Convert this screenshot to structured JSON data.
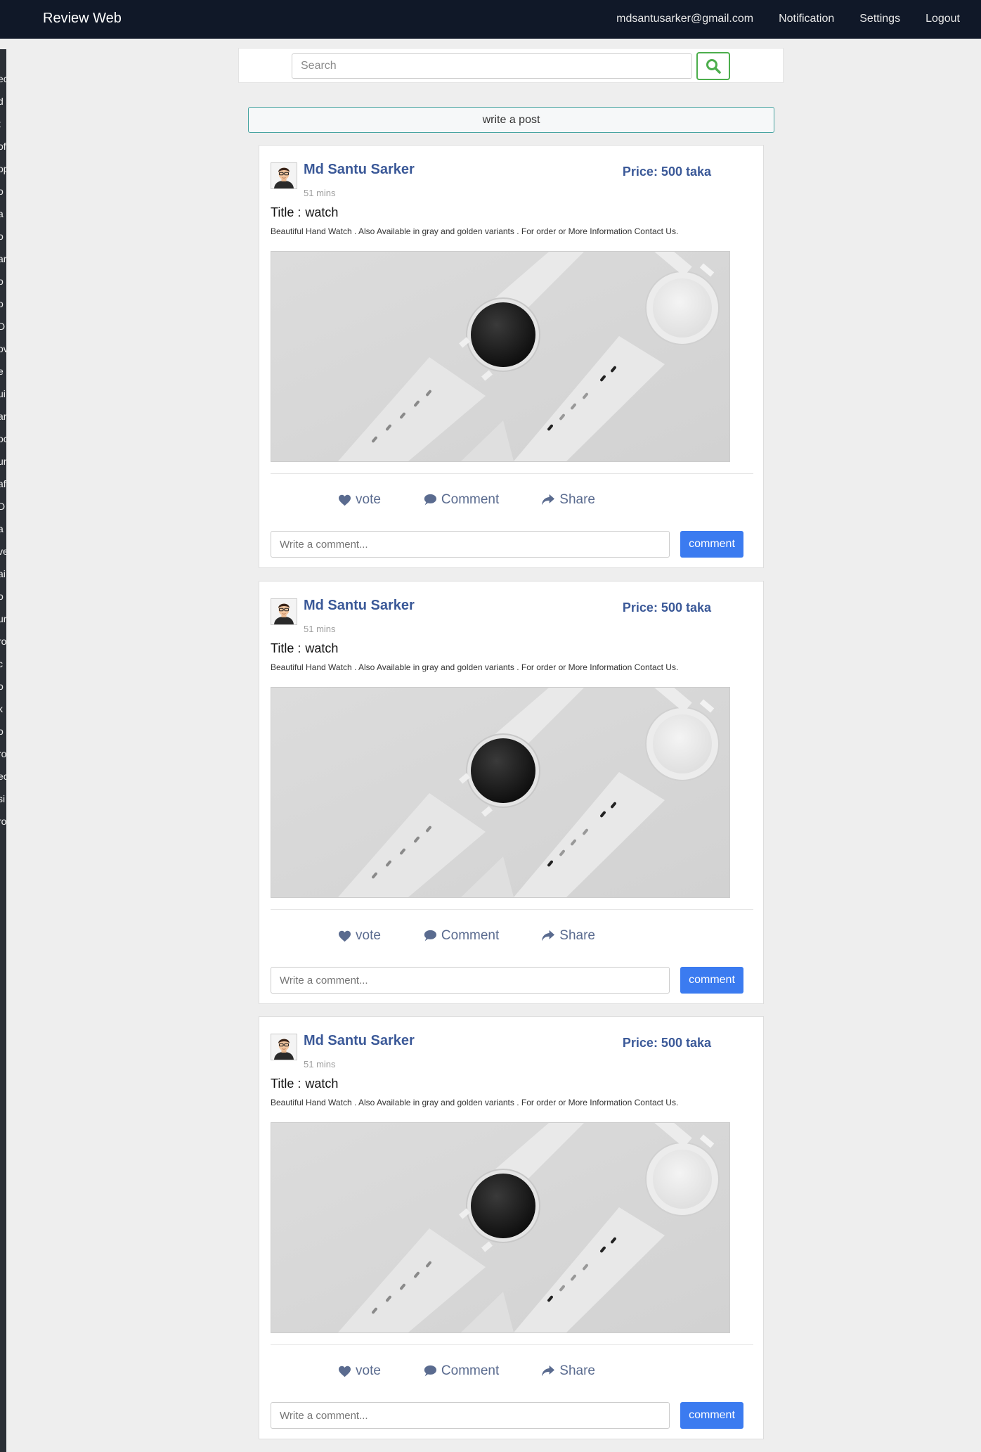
{
  "navbar": {
    "brand": "Review Web",
    "email": "mdsantusarker@gmail.com",
    "notification": "Notification",
    "settings": "Settings",
    "logout": "Logout"
  },
  "sidebar": {
    "items": [
      "ec",
      "d",
      "t",
      "of",
      "op",
      "o",
      "a",
      "o",
      "ar",
      "o",
      "o",
      "D",
      "ov",
      "e",
      "ui",
      "ar",
      "oc",
      "ur",
      "af",
      "D",
      "a",
      "ve",
      "ai",
      "o",
      "ur",
      "ro",
      "c",
      "o",
      "k",
      "o",
      "ro",
      "ec",
      "si",
      "ro"
    ]
  },
  "search": {
    "placeholder": "Search",
    "icon": "search-icon"
  },
  "write_post": {
    "label": "write a post"
  },
  "posts": [
    {
      "author": "Md Santu Sarker",
      "time": "51 mins",
      "price": "Price: 500 taka",
      "title_label": "Title :",
      "title": "watch",
      "description": "Beautiful Hand Watch . Also Available in gray and golden variants . For order or More Information Contact Us.",
      "vote": "vote",
      "comment": "Comment",
      "share": "Share",
      "comment_placeholder": "Write a comment...",
      "comment_button": "comment"
    },
    {
      "author": "Md Santu Sarker",
      "time": "51 mins",
      "price": "Price: 500 taka",
      "title_label": "Title :",
      "title": "watch",
      "description": "Beautiful Hand Watch . Also Available in gray and golden variants . For order or More Information Contact Us.",
      "vote": "vote",
      "comment": "Comment",
      "share": "Share",
      "comment_placeholder": "Write a comment...",
      "comment_button": "comment"
    },
    {
      "author": "Md Santu Sarker",
      "time": "51 mins",
      "price": "Price: 500 taka",
      "title_label": "Title :",
      "title": "watch",
      "description": "Beautiful Hand Watch . Also Available in gray and golden variants . For order or More Information Contact Us.",
      "vote": "vote",
      "comment": "Comment",
      "share": "Share",
      "comment_placeholder": "Write a comment...",
      "comment_button": "comment"
    }
  ],
  "colors": {
    "navbar": "#101828",
    "author": "#3b5998",
    "comment_button": "#3b7bf0",
    "search_border": "#4cae4c"
  }
}
